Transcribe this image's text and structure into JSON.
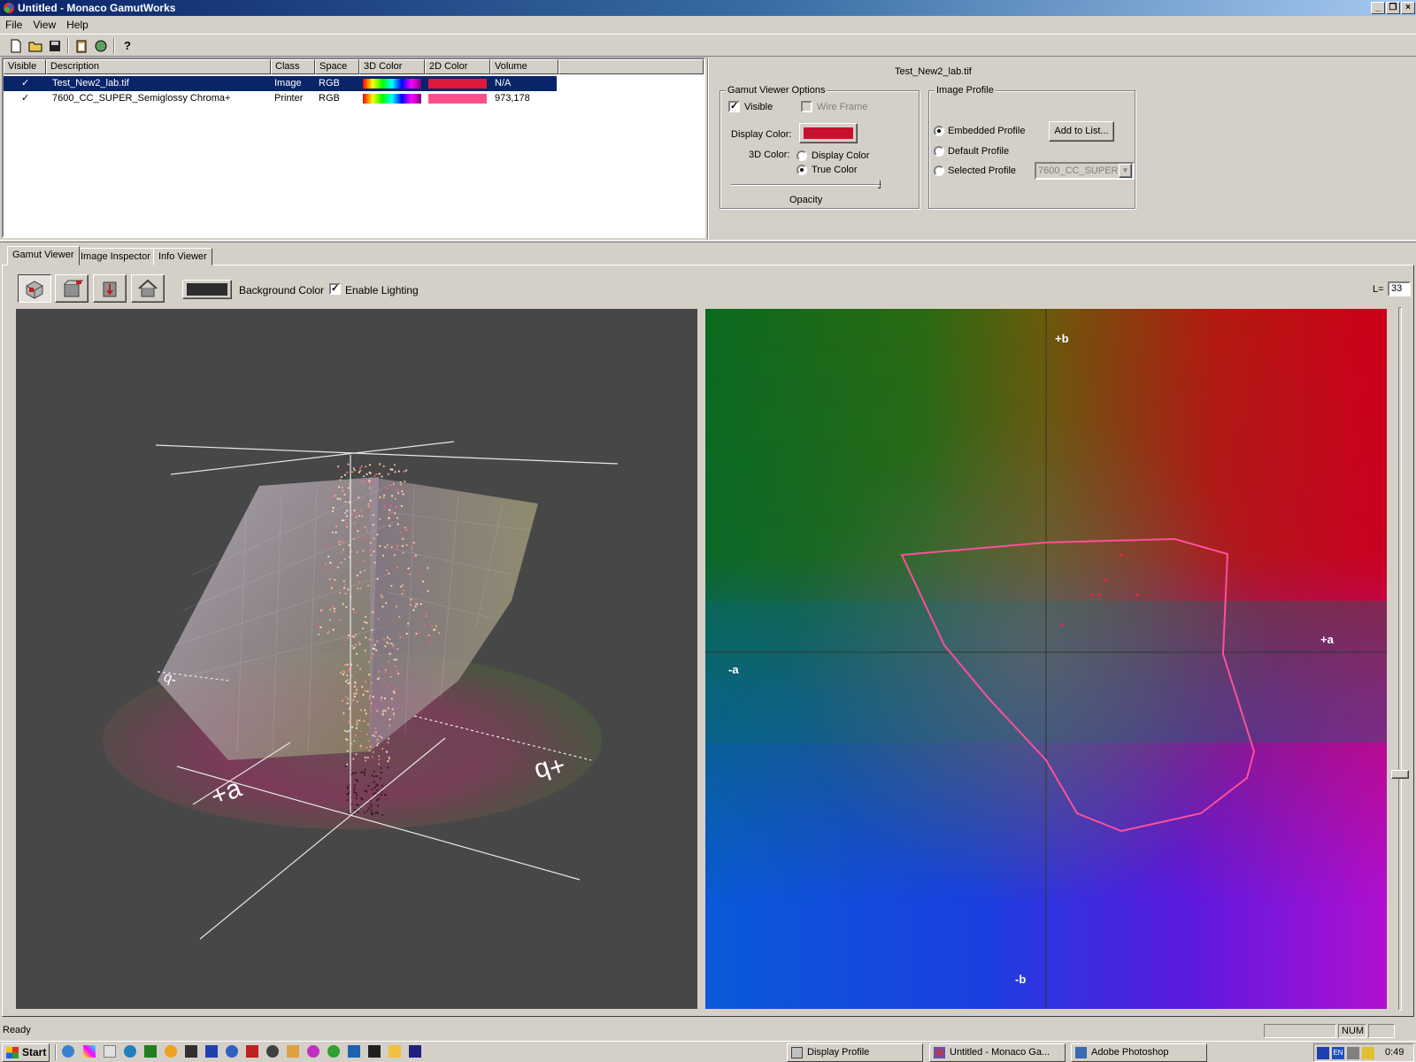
{
  "window": {
    "title": "Untitled - Monaco GamutWorks"
  },
  "menu": [
    "File",
    "View",
    "Help"
  ],
  "toolbar": {
    "icons": [
      "new-file-icon",
      "open-folder-icon",
      "save-icon",
      "clipboard-icon",
      "export-icon",
      "help-icon"
    ]
  },
  "list": {
    "columns": [
      "Visible",
      "Description",
      "Class",
      "Space",
      "3D Color",
      "2D Color",
      "Volume"
    ],
    "rows": [
      {
        "visible": "✓",
        "description": "Test_New2_lab.tif",
        "class": "Image",
        "space": "RGB",
        "color2d": "#dd1a3a",
        "volume": "N/A",
        "selected": true
      },
      {
        "visible": "✓",
        "description": "7600_CC_SUPER_Semiglossy Chroma+",
        "class": "Printer",
        "space": "RGB",
        "color2d": "#ff4f8a",
        "volume": "973,178",
        "selected": false
      }
    ]
  },
  "options": {
    "file_title": "Test_New2_lab.tif",
    "gamut_group_title": "Gamut Viewer Options",
    "visible_label": "Visible",
    "visible_checked": true,
    "wireframe_label": "Wire Frame",
    "wireframe_checked": false,
    "display_color_label": "Display Color:",
    "display_color": "#c8102e",
    "color3d_label": "3D Color:",
    "color3d_option_display": "Display Color",
    "color3d_option_true": "True Color",
    "color3d_selected": "True Color",
    "opacity_label": "Opacity",
    "opacity_value": 1.0,
    "profile_group_title": "Image Profile",
    "embedded_label": "Embedded Profile",
    "default_label": "Default Profile",
    "selected_label": "Selected Profile",
    "profile_selected": "Embedded Profile",
    "add_to_list_label": "Add to List...",
    "profile_dropdown_value": "7600_CC_SUPER_"
  },
  "tabs": [
    "Gamut Viewer",
    "Image Inspector",
    "Info Viewer"
  ],
  "active_tab": "Gamut Viewer",
  "viewer": {
    "background_color_label": "Background Color",
    "background_color": "#2d2d2d",
    "enable_lighting_label": "Enable Lighting",
    "enable_lighting_checked": true,
    "l_label": "L=",
    "l_value": "33",
    "view_buttons": [
      "cube-view-icon",
      "top-view-icon",
      "side-view-icon",
      "home-view-icon"
    ]
  },
  "view3d": {
    "axis_a": "+a",
    "axis_b_pos": "+b",
    "axis_b_neg": "-b"
  },
  "view2d": {
    "plus_b": "+b",
    "minus_b": "-b",
    "plus_a": "+a",
    "minus_a": "-a",
    "outline_color": "#ff4f9a"
  },
  "status": {
    "text": "Ready",
    "num": "NUM"
  },
  "taskbar": {
    "start_label": "Start",
    "tasks": [
      {
        "label": "Display Profile",
        "active": false
      },
      {
        "label": "Untitled - Monaco Ga...",
        "active": true
      },
      {
        "label": "Adobe Photoshop",
        "active": false
      }
    ],
    "time": "0:49"
  }
}
